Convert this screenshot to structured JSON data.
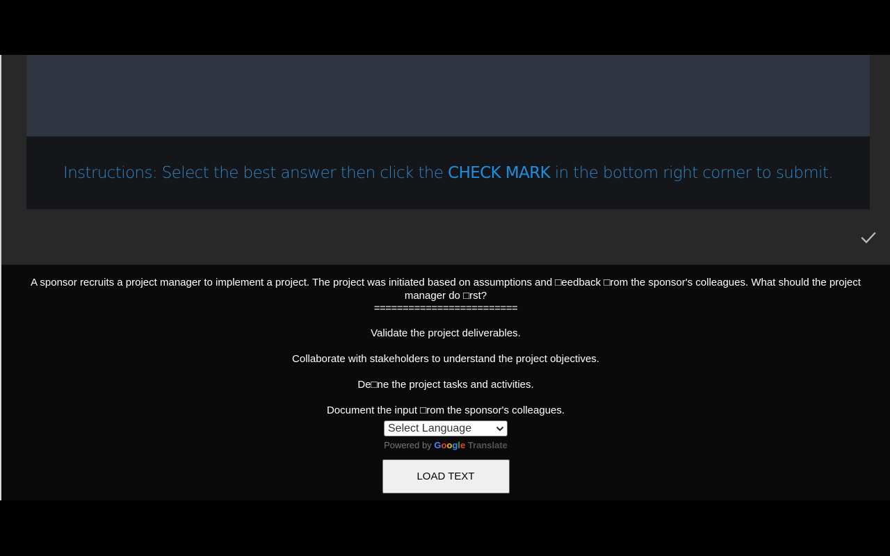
{
  "instructions": {
    "prefix": "Instructions: Select the best answer then click the ",
    "emphasis": "CHECK MARK",
    "suffix": " in the bottom right corner to submit."
  },
  "submit": {
    "icon": "check-icon",
    "color": "#bfbfbf"
  },
  "question": {
    "text": "A sponsor recruits a project manager to implement a project. The project was initiated based on assumptions and □eedback □rom the sponsor's colleagues. What should the project manager do □rst?",
    "separator": "========================="
  },
  "answers": [
    {
      "label": "Validate the project deliverables."
    },
    {
      "label": "Collaborate with stakeholders to understand the project objectives."
    },
    {
      "label": "De□ne the project tasks and activities."
    },
    {
      "label": "Document the input □rom the sponsor's colleagues."
    }
  ],
  "translate": {
    "select_label": "Select Language",
    "powered_by": "Powered by",
    "google": "Google",
    "translate_word": "Translate"
  },
  "load_button": {
    "label": "LOAD TEXT"
  },
  "colors": {
    "accent": "#1e8fe0",
    "header_bg": "#2e3440",
    "instructions_bg": "#141619",
    "player_bg": "#282828",
    "text_panel_bg": "#0a0a0a"
  }
}
